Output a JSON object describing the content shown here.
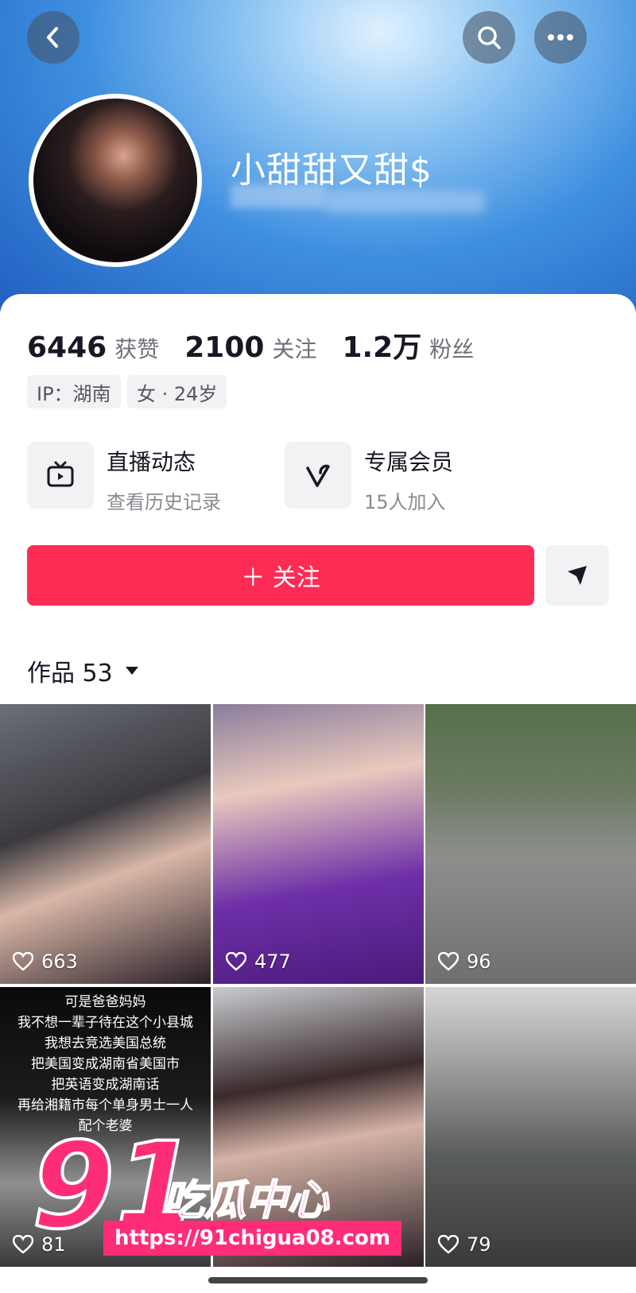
{
  "profile": {
    "name": "小甜甜又甜$",
    "stats": [
      {
        "num": "6446",
        "label": "获赞"
      },
      {
        "num": "2100",
        "label": "关注"
      },
      {
        "num": "1.2万",
        "label": "粉丝"
      }
    ],
    "tags": [
      "IP：湖南",
      "女 · 24岁"
    ]
  },
  "features": [
    {
      "title": "直播动态",
      "sub": "查看历史记录",
      "icon": "tv-icon"
    },
    {
      "title": "专属会员",
      "sub": "15人加入",
      "icon": "v-heart-icon"
    }
  ],
  "follow_label": "＋ 关注",
  "works_label": "作品 53",
  "videos": [
    {
      "likes": "663"
    },
    {
      "likes": "477"
    },
    {
      "likes": "96"
    },
    {
      "likes": "81",
      "caption": [
        "可是爸爸妈妈",
        "我不想一辈子待在这个小县城",
        "我想去竞选美国总统",
        "把美国变成湖南省美国市",
        "把英语变成湖南话",
        "再给湘籍市每个单身男士一人",
        "配个老婆"
      ]
    },
    {
      "likes": ""
    },
    {
      "likes": "79"
    }
  ],
  "watermark": {
    "num": "91",
    "cn": "吃瓜中心",
    "url": "https://91chigua08.com"
  },
  "colors": {
    "accent": "#fe2c55",
    "watermark": "#ff2d78"
  }
}
